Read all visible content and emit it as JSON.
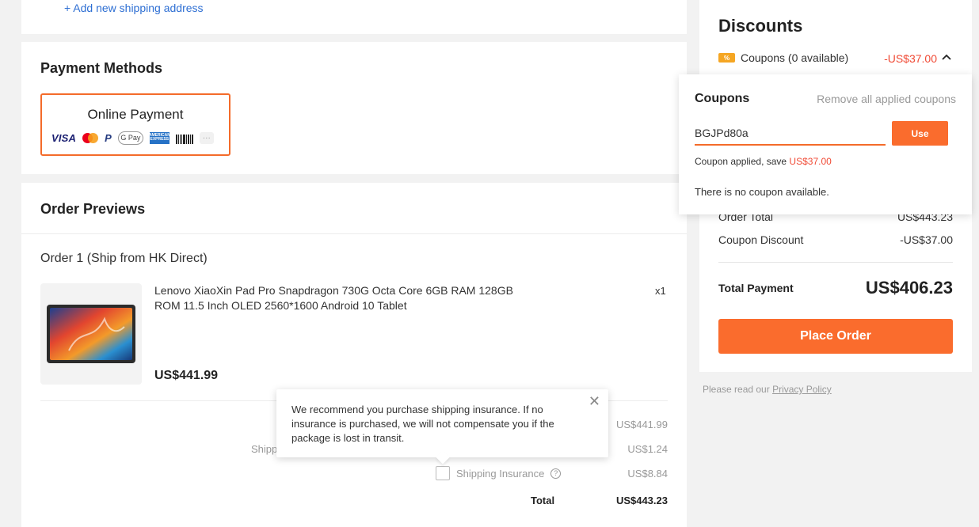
{
  "address": {
    "add_link": "+ Add new shipping address"
  },
  "payment": {
    "title": "Payment Methods",
    "option_label": "Online Payment",
    "logos": {
      "visa": "VISA",
      "paypal": "P",
      "gpay": "G Pay",
      "amex": "AMERICAN EXPRESS",
      "more": "···"
    }
  },
  "order": {
    "title": "Order Previews",
    "subtitle": "Order 1 (Ship from HK Direct)",
    "product": {
      "name": "Lenovo XiaoXin Pad Pro Snapdragon 730G Octa Core 6GB RAM 128GB ROM 11.5 Inch OLED 2560*1600 Android 10 Tablet",
      "qty": "x1",
      "price": "US$441.99"
    },
    "summary": {
      "subtotal_val": "US$441.99",
      "shipping_label_partial": "Shipp",
      "shipping_val": "US$1.24",
      "insurance_label": "Shipping Insurance",
      "insurance_help": "?",
      "insurance_val": "US$8.84",
      "total_label": "Total",
      "total_val": "US$443.23"
    },
    "tooltip": {
      "text": "We recommend you purchase shipping insurance. If no insurance is purchased, we will not compensate you if the package is lost in transit.",
      "close": "✕"
    }
  },
  "right": {
    "title": "Discounts",
    "coupon_icon": "%",
    "coupon_label": "Coupons (0 available)",
    "coupon_amount": "-US$37.00",
    "order_total_label": "Order Total",
    "order_total_val": "US$443.23",
    "coupon_discount_label": "Coupon Discount",
    "coupon_discount_val": "-US$37.00",
    "total_payment_label": "Total Payment",
    "total_payment_val": "US$406.23",
    "place_order": "Place Order",
    "privacy_prefix": "Please read our ",
    "privacy_link": "Privacy Policy"
  },
  "coupon_popup": {
    "title": "Coupons",
    "remove_all": "Remove all applied coupons",
    "input_value": "BGJPd80a",
    "use_label": "Use",
    "applied_prefix": "Coupon applied, save ",
    "applied_amount": "US$37.00",
    "none_text": "There is no coupon available."
  },
  "colors": {
    "accent": "#fa6c2d",
    "discount_red": "#f04a35",
    "link_blue": "#2e6fd3"
  }
}
